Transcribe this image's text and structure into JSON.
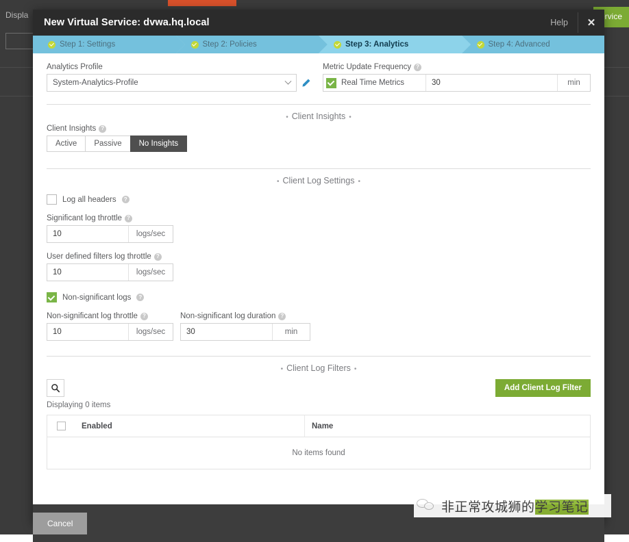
{
  "background": {
    "displaying_text": "Displa",
    "green_button_label": "ervice"
  },
  "modal": {
    "title": "New Virtual Service: dvwa.hq.local",
    "help_label": "Help",
    "close_icon": "close-icon",
    "steps": [
      {
        "label": "Step 1: Settings",
        "active": false
      },
      {
        "label": "Step 2: Policies",
        "active": false
      },
      {
        "label": "Step 3: Analytics",
        "active": true
      },
      {
        "label": "Step 4: Advanced",
        "active": false
      }
    ],
    "analytics_profile": {
      "label": "Analytics Profile",
      "value": "System-Analytics-Profile",
      "chevron_icon": "chevron-down-icon",
      "edit_icon": "pencil-icon"
    },
    "metric_update_frequency": {
      "label": "Metric Update Frequency",
      "help_icon": "question-icon",
      "checkbox_label": "Real Time Metrics",
      "checked": true,
      "value": "30",
      "unit": "min"
    },
    "sections": {
      "client_insights": "Client Insights",
      "client_log_settings": "Client Log Settings",
      "client_log_filters": "Client Log Filters"
    },
    "client_insights": {
      "label": "Client Insights",
      "help_icon": "question-icon",
      "options": [
        "Active",
        "Passive",
        "No Insights"
      ],
      "selected": "No Insights"
    },
    "log_all_headers": {
      "label": "Log all headers",
      "checked": false,
      "help_icon": "question-icon"
    },
    "significant_log_throttle": {
      "label": "Significant log throttle",
      "value": "10",
      "unit": "logs/sec",
      "help_icon": "question-icon"
    },
    "user_defined_filters_log_throttle": {
      "label": "User defined filters log throttle",
      "value": "10",
      "unit": "logs/sec",
      "help_icon": "question-icon"
    },
    "non_significant_logs": {
      "label": "Non-significant logs",
      "checked": true,
      "help_icon": "question-icon"
    },
    "non_significant_log_throttle": {
      "label": "Non-significant log throttle",
      "value": "10",
      "unit": "logs/sec",
      "help_icon": "question-icon"
    },
    "non_significant_log_duration": {
      "label": "Non-significant log duration",
      "value": "30",
      "unit": "min",
      "help_icon": "question-icon"
    },
    "filters_toolbar": {
      "search_icon": "search-icon",
      "displaying_text": "Displaying 0 items",
      "add_button_label": "Add Client Log Filter"
    },
    "filters_table": {
      "columns": [
        "Enabled",
        "Name"
      ],
      "empty_text": "No items found",
      "rows": []
    },
    "footer": {
      "cancel_label": "Cancel"
    }
  },
  "watermark": {
    "text_plain": "非正常攻城狮的",
    "text_highlight": "学习笔记",
    "logo_icon": "wechat-logo-icon"
  },
  "colors": {
    "accent_blue": "#74c1dd",
    "accent_blue_active": "#8dd3ea",
    "green_button": "#7cab34",
    "green_check": "#7ab547",
    "step_dot": "#c3d838",
    "header_dark": "#2b2b2b",
    "footer_dark": "#3d3d3d",
    "selected_toggle": "#4f4f4f"
  }
}
